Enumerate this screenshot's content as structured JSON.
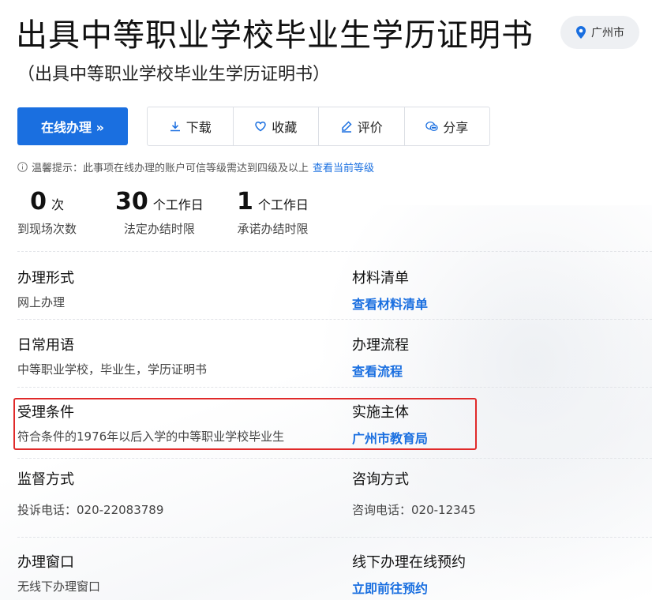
{
  "header": {
    "title": "出具中等职业学校毕业生学历证明书",
    "subtitle": "（出具中等职业学校毕业生学历证明书）",
    "location": "广州市"
  },
  "actions": {
    "online": "在线办理 »",
    "download": "下载",
    "favorite": "收藏",
    "review": "评价",
    "share": "分享"
  },
  "tip": {
    "text": "温馨提示：此事项在线办理的账户可信等级需达到四级及以上",
    "link": "查看当前等级"
  },
  "stats": [
    {
      "num": "0",
      "unit": "次",
      "caption": "到现场次数"
    },
    {
      "num": "30",
      "unit": "个工作日",
      "caption": "法定办结时限"
    },
    {
      "num": "1",
      "unit": "个工作日",
      "caption": "承诺办结时限"
    }
  ],
  "details": {
    "form": {
      "label": "办理形式",
      "value": "网上办理"
    },
    "materials": {
      "label": "材料清单",
      "link": "查看材料清单"
    },
    "terms": {
      "label": "日常用语",
      "value": "中等职业学校，毕业生，学历证明书"
    },
    "process": {
      "label": "办理流程",
      "link": "查看流程"
    },
    "conditions": {
      "label": "受理条件",
      "value": "符合条件的1976年以后入学的中等职业学校毕业生"
    },
    "agency": {
      "label": "实施主体",
      "link": "广州市教育局"
    },
    "supervision": {
      "label": "监督方式",
      "value": "投诉电话：020-22083789"
    },
    "consult": {
      "label": "咨询方式",
      "value": "咨询电话：020-12345"
    },
    "window": {
      "label": "办理窗口",
      "value": "无线下办理窗口"
    },
    "appointment": {
      "label": "线下办理在线预约",
      "link": "立即前往预约"
    }
  },
  "colors": {
    "accent": "#1a6fe0",
    "highlight": "#e02a2a"
  }
}
